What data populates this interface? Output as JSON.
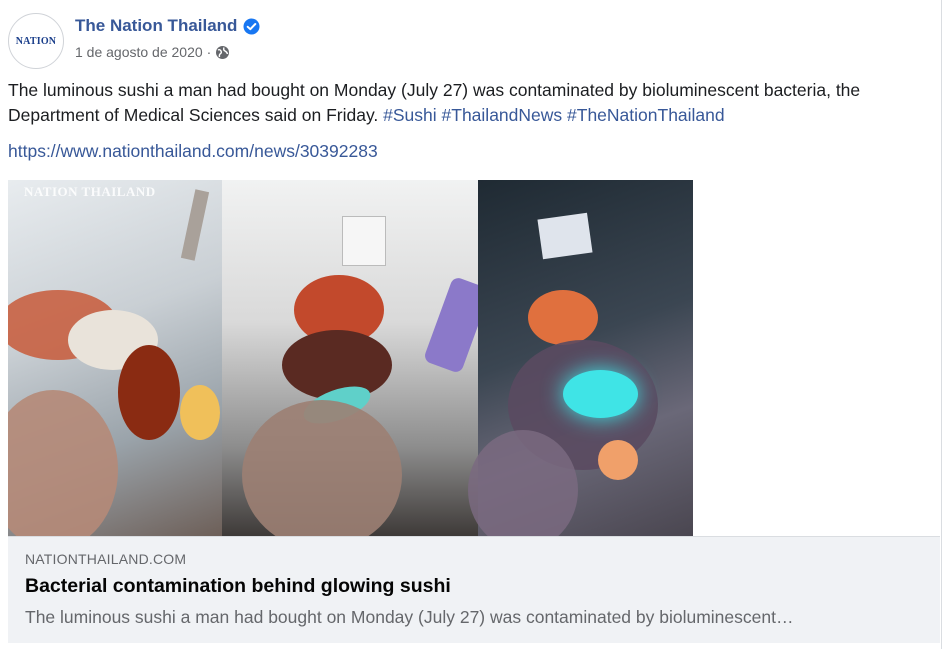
{
  "post": {
    "page_name": "The Nation Thailand",
    "avatar_text": "NATION",
    "date": "1 de agosto de 2020",
    "separator": "·",
    "body_text": "The luminous sushi a man had bought on Monday (July 27) was contaminated by bioluminescent bacteria, the Department of Medical Sciences said on Friday.",
    "hashtags": [
      "#Sushi",
      "#ThailandNews",
      "#TheNationThailand"
    ],
    "link_url": "https://www.nationthailand.com/news/30392283"
  },
  "image": {
    "watermark": "NATION THAILAND"
  },
  "link_card": {
    "domain": "NATIONTHAILAND.COM",
    "title": "Bacterial contamination behind glowing sushi",
    "description": "The luminous sushi a man had bought on Monday (July 27) was contaminated by bioluminescent…"
  },
  "icons": {
    "verified": "verified-badge-icon",
    "audience": "globe-icon"
  },
  "colors": {
    "link": "#385898",
    "verified": "#1877f2",
    "glow": "#3fe4e6",
    "card_bg": "#f0f2f5"
  }
}
